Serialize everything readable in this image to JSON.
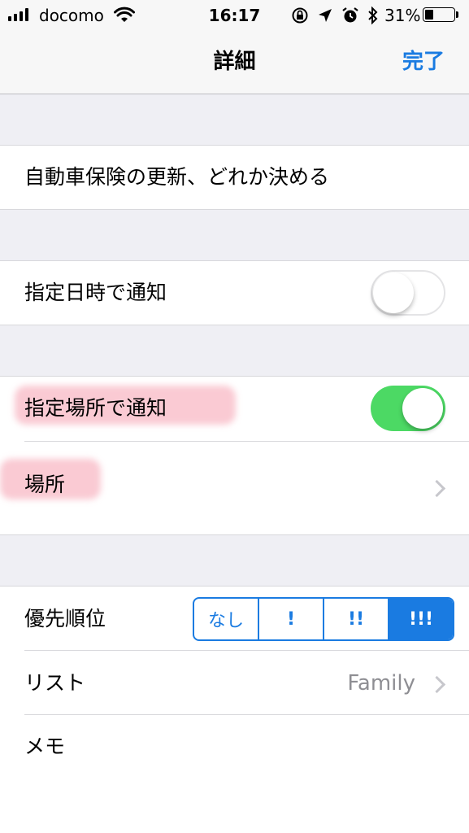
{
  "status_bar": {
    "carrier": "docomo",
    "time": "16:17",
    "battery_percent": "31%",
    "battery_level": 0.31,
    "icons": [
      "signal-icon",
      "wifi-icon",
      "rotation-lock-icon",
      "location-icon",
      "alarm-icon",
      "bluetooth-icon",
      "battery-icon"
    ]
  },
  "nav": {
    "title": "詳細",
    "done_label": "完了"
  },
  "task": {
    "title": "自動車保険の更新、どれか決める"
  },
  "date_notify": {
    "label": "指定日時で通知",
    "enabled": false
  },
  "location_notify": {
    "label": "指定場所で通知",
    "enabled": true
  },
  "location": {
    "label": "場所"
  },
  "priority": {
    "label": "優先順位",
    "options": [
      "なし",
      "!",
      "!!",
      "!!!"
    ],
    "selected": "!!!"
  },
  "list": {
    "label": "リスト",
    "value": "Family"
  },
  "memo": {
    "label": "メモ"
  },
  "colors": {
    "accent": "#1a7be1",
    "toggle_on": "#4cd964",
    "background": "#efeff4",
    "highlight": "#f48096"
  }
}
